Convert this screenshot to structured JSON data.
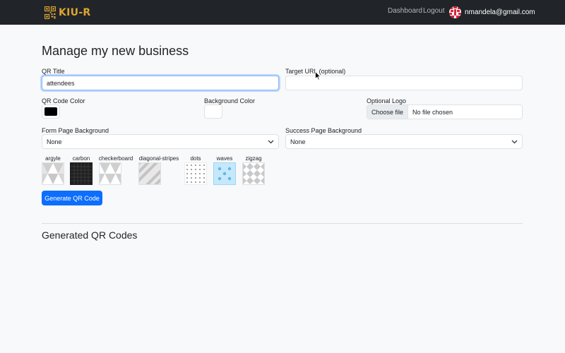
{
  "navbar": {
    "brand": "KIU-R",
    "links": {
      "dashboard": "Dashboard",
      "logout": "Logout"
    },
    "user_email": "nmandela@gmail.com",
    "brand_color": "#e0a431",
    "background": "#212529"
  },
  "page": {
    "title": "Manage my new business"
  },
  "form": {
    "qr_title": {
      "label": "QR Title",
      "value": "attendees"
    },
    "target_url": {
      "label": "Target URL (optional)",
      "value": ""
    },
    "qr_code_color": {
      "label": "QR Code Color",
      "value": "#000000"
    },
    "background_color": {
      "label": "Background Color",
      "value": "#ffffff"
    },
    "optional_logo": {
      "label": "Optional Logo",
      "button": "Choose file",
      "status": "No file chosen"
    },
    "form_page_background": {
      "label": "Form Page Background",
      "selected": "None"
    },
    "success_page_background": {
      "label": "Success Page Background",
      "selected": "None"
    },
    "patterns": [
      "argyle",
      "carbon",
      "checkerboard",
      "diagonal-stripes",
      "dots",
      "waves",
      "zigzag"
    ],
    "submit_label": "Generate QR Code"
  },
  "generated_section": {
    "title": "Generated QR Codes"
  },
  "colors": {
    "primary": "#0d6efd",
    "focus": "#86b7fe"
  }
}
